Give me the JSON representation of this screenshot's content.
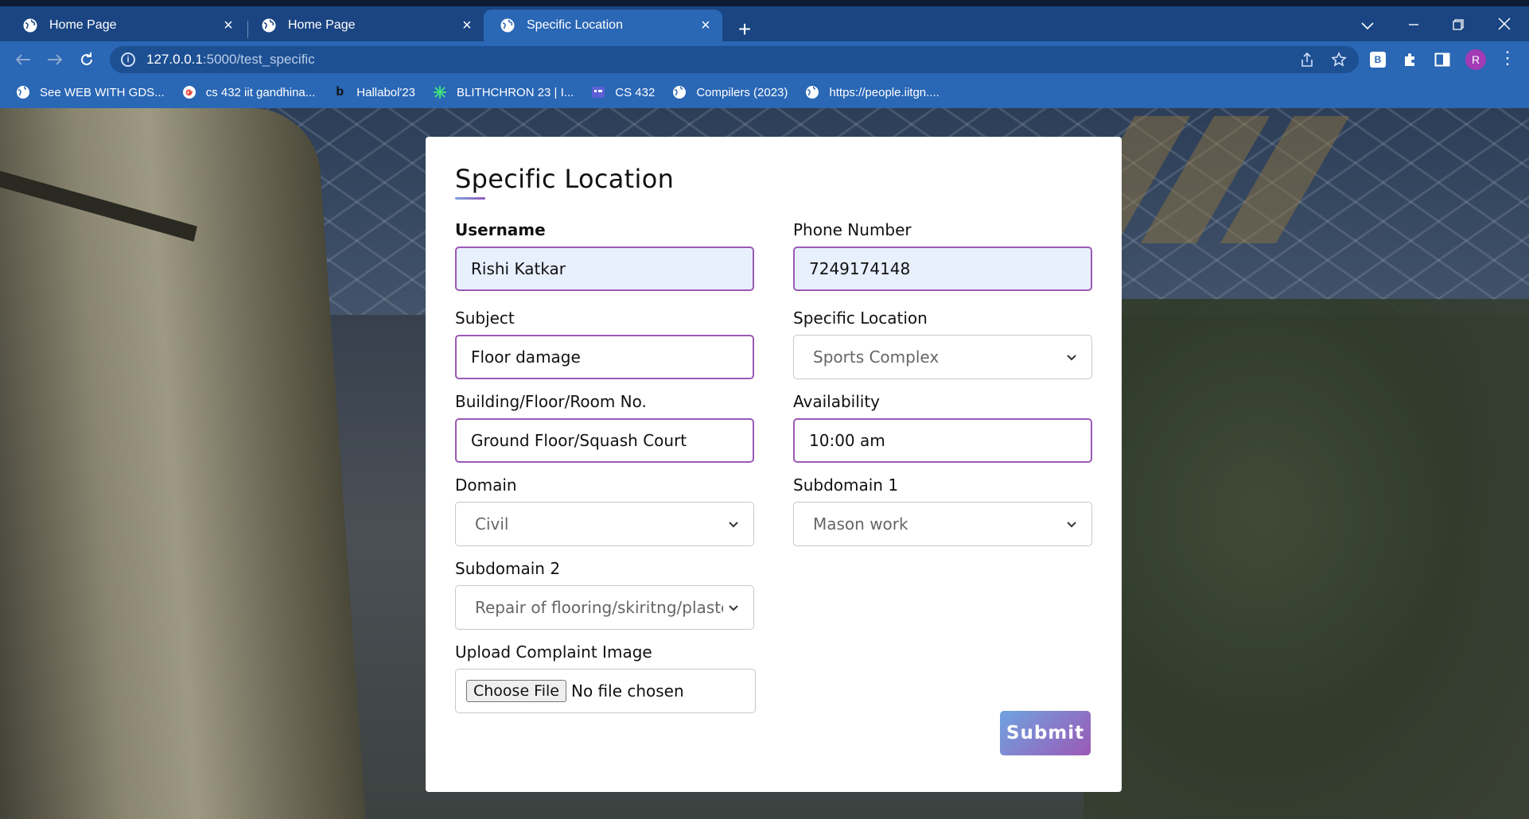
{
  "browser": {
    "tabs": [
      {
        "title": "Home Page"
      },
      {
        "title": "Home Page"
      },
      {
        "title": "Specific Location"
      }
    ],
    "url_host": "127.0.0.1",
    "url_path": ":5000/test_specific",
    "avatar_initial": "R",
    "extension_label": "B",
    "bookmarks": [
      {
        "label": "See WEB WITH GDS..."
      },
      {
        "label": "cs 432 iit gandhina..."
      },
      {
        "label": "Hallabol'23"
      },
      {
        "label": "BLITHCHRON 23 | I..."
      },
      {
        "label": "CS 432"
      },
      {
        "label": "Compilers (2023)"
      },
      {
        "label": "https://people.iitgn...."
      }
    ]
  },
  "form": {
    "title": "Specific Location",
    "username": {
      "label": "Username",
      "value": "Rishi Katkar"
    },
    "phone": {
      "label": "Phone Number",
      "value": "7249174148"
    },
    "subject": {
      "label": "Subject",
      "value": "Floor damage"
    },
    "specific_location": {
      "label": "Specific Location",
      "value": "Sports Complex"
    },
    "building": {
      "label": "Building/Floor/Room No.",
      "value": "Ground Floor/Squash Court"
    },
    "availability": {
      "label": "Availability",
      "value": "10:00 am"
    },
    "domain": {
      "label": "Domain",
      "value": "Civil"
    },
    "subdomain1": {
      "label": "Subdomain 1",
      "value": "Mason work"
    },
    "subdomain2": {
      "label": "Subdomain 2",
      "value": "Repair of flooring/skiritng/plaster"
    },
    "upload": {
      "label": "Upload Complaint Image",
      "button": "Choose File",
      "status": "No file chosen"
    },
    "submit_label": "Submit"
  },
  "colors": {
    "tabbar": "#1a4582",
    "toolbar": "#2a67b5",
    "accent_purple": "#9b59b6",
    "accent_blue": "#6fa3e0",
    "filled_input_bg": "#e8effd"
  }
}
